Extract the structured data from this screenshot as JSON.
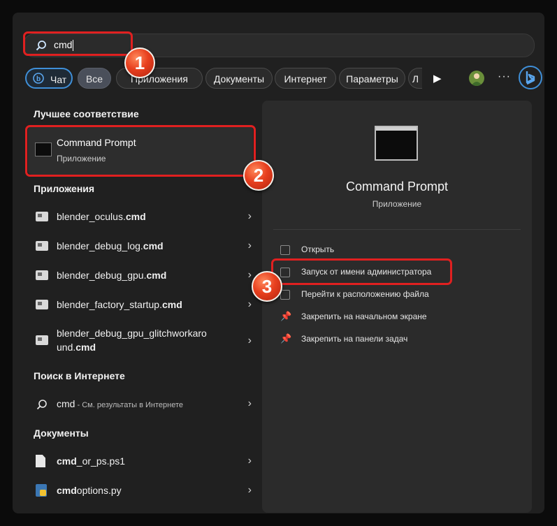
{
  "search": {
    "value": "cmd"
  },
  "filters": {
    "chat": "Чат",
    "all": "Все",
    "apps": "Приложения",
    "documents": "Документы",
    "internet": "Интернет",
    "settings": "Параметры",
    "partial": "Л",
    "more_icon": "▶",
    "dots": "···"
  },
  "best_match": {
    "header": "Лучшее соответствие",
    "title": "Command Prompt",
    "subtitle": "Приложение"
  },
  "apps": {
    "header": "Приложения",
    "items": [
      {
        "name": "blender_oculus.",
        "ext": "cmd"
      },
      {
        "name": "blender_debug_log.",
        "ext": "cmd"
      },
      {
        "name": "blender_debug_gpu.",
        "ext": "cmd"
      },
      {
        "name": "blender_factory_startup.",
        "ext": "cmd"
      },
      {
        "name": "blender_debug_gpu_glitchworkaro und.",
        "ext": "cmd"
      }
    ]
  },
  "web": {
    "header": "Поиск в Интернете",
    "query": "cmd",
    "sub": " - См. результаты в Интернете"
  },
  "documents": {
    "header": "Документы",
    "items": [
      {
        "bold": "cmd",
        "rest": "_or_ps.ps1"
      },
      {
        "bold": "cmd",
        "rest": "options.py"
      }
    ]
  },
  "preview": {
    "title": "Command Prompt",
    "subtitle": "Приложение",
    "actions": [
      "Открыть",
      "Запуск от имени администратора",
      "Перейти к расположению файла",
      "Закрепить на начальном экране",
      "Закрепить на панели задач"
    ]
  },
  "markers": {
    "one": "1",
    "two": "2",
    "three": "3"
  },
  "colors": {
    "annotation": "#e02020",
    "accent": "#3f8fd8",
    "background": "#202020"
  }
}
